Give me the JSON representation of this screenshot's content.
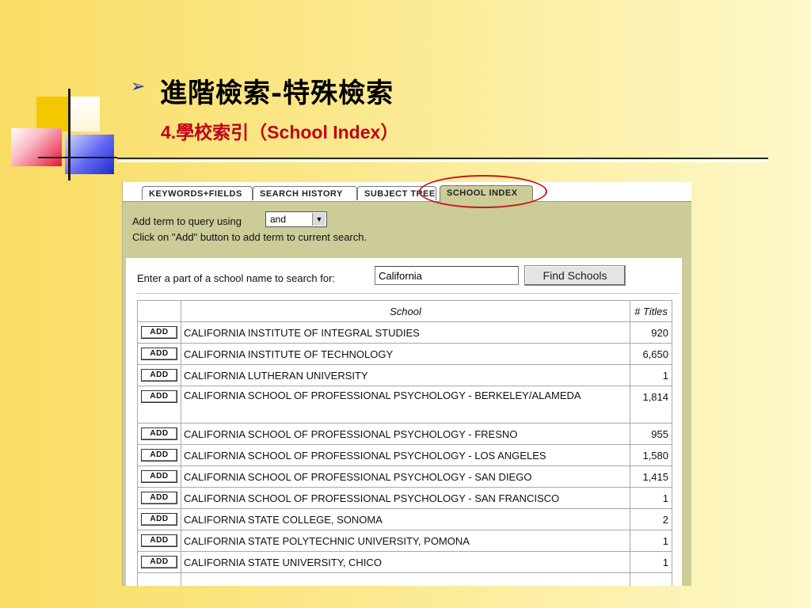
{
  "title": "進階檢索-特殊檢索",
  "subtitle": "4.學校索引（School Index）",
  "tabs": [
    {
      "label": "KEYWORDS+FIELDS"
    },
    {
      "label": "SEARCH HISTORY"
    },
    {
      "label": "SUBJECT TREE"
    },
    {
      "label": "SCHOOL INDEX"
    }
  ],
  "query": {
    "add_term_label": "Add term to query using",
    "operator_value": "and",
    "instructions": "Click on \"Add\" button to add term to current search."
  },
  "search": {
    "label": "Enter a part of a school name to search for:",
    "value": "California",
    "button_label": "Find Schools"
  },
  "table": {
    "headers": {
      "school": "School",
      "titles": "# Titles"
    },
    "add_label": "ADD",
    "rows": [
      {
        "school": "CALIFORNIA INSTITUTE OF INTEGRAL STUDIES",
        "titles": "920"
      },
      {
        "school": "CALIFORNIA INSTITUTE OF TECHNOLOGY",
        "titles": "6,650"
      },
      {
        "school": "CALIFORNIA LUTHERAN UNIVERSITY",
        "titles": "1"
      },
      {
        "school": "CALIFORNIA SCHOOL OF PROFESSIONAL PSYCHOLOGY - BERKELEY/ALAMEDA",
        "titles": "1,814"
      },
      {
        "school": "CALIFORNIA SCHOOL OF PROFESSIONAL PSYCHOLOGY - FRESNO",
        "titles": "955"
      },
      {
        "school": "CALIFORNIA SCHOOL OF PROFESSIONAL PSYCHOLOGY - LOS ANGELES",
        "titles": "1,580"
      },
      {
        "school": "CALIFORNIA SCHOOL OF PROFESSIONAL PSYCHOLOGY - SAN DIEGO",
        "titles": "1,415"
      },
      {
        "school": "CALIFORNIA SCHOOL OF PROFESSIONAL PSYCHOLOGY - SAN FRANCISCO",
        "titles": "1"
      },
      {
        "school": "CALIFORNIA STATE COLLEGE, SONOMA",
        "titles": "2"
      },
      {
        "school": "CALIFORNIA STATE POLYTECHNIC UNIVERSITY, POMONA",
        "titles": "1"
      },
      {
        "school": "CALIFORNIA STATE UNIVERSITY, CHICO",
        "titles": "1"
      }
    ]
  },
  "colors": {
    "title_red": "#c0001a",
    "panel_bg": "#cccc99",
    "highlight_circle": "#c21b1b"
  }
}
